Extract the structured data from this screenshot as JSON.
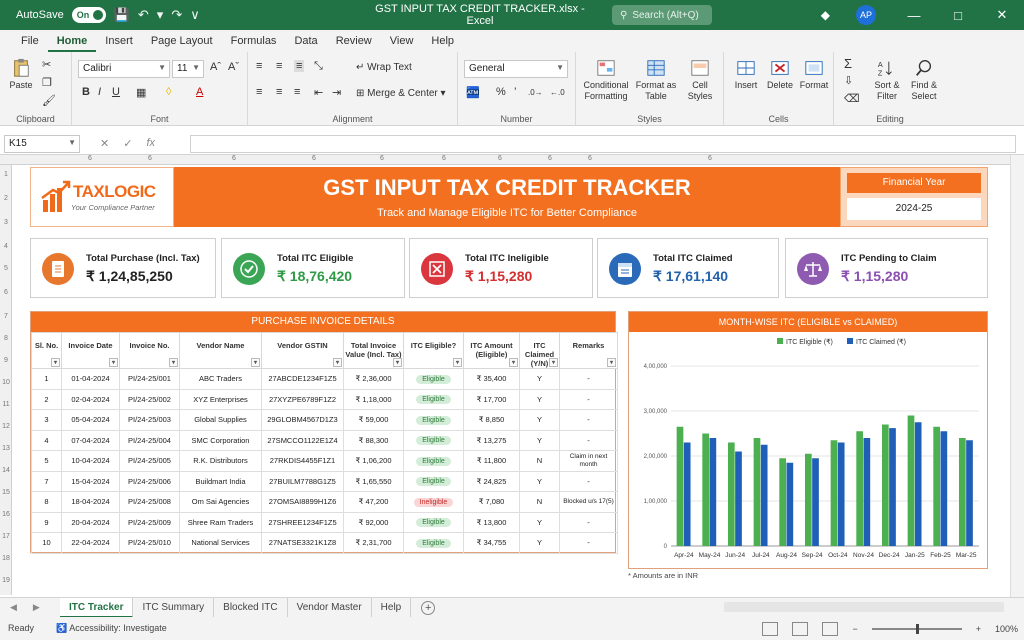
{
  "titlebar": {
    "autosave_label": "AutoSave",
    "toggle_state": "On",
    "filename": "GST INPUT TAX CREDIT TRACKER.xlsx",
    "app_name": "Excel",
    "separator": "-",
    "search_placeholder": "Search (Alt+Q)",
    "avatar_initials": "AP"
  },
  "menu": {
    "tabs": [
      "File",
      "Home",
      "Insert",
      "Page Layout",
      "Formulas",
      "Data",
      "Review",
      "View",
      "Help"
    ],
    "active": "Home"
  },
  "ribbon": {
    "clipboard": {
      "paste": "Paste",
      "label": "Clipboard"
    },
    "font": {
      "name": "Calibri",
      "size": "11",
      "label": "Font"
    },
    "alignment": {
      "wrap_text": "Wrap Text",
      "merge_center": "Merge & Center",
      "label": "Alignment"
    },
    "number": {
      "format": "General",
      "label": "Number"
    },
    "styles": {
      "conditional": "Conditional Formatting",
      "format_table": "Format as Table",
      "cell_styles": "Cell Styles",
      "label": "Styles"
    },
    "cells": {
      "insert": "Insert",
      "delete": "Delete",
      "format": "Format",
      "label": "Cells"
    },
    "editing": {
      "sort_filter": "Sort & Filter",
      "find_select": "Find & Select",
      "label": "Editing"
    }
  },
  "formula_bar": {
    "name_box": "K15",
    "fx": "fx",
    "content": ""
  },
  "column_headers": [
    "6",
    "6",
    "6",
    "6",
    "6",
    "6",
    "6",
    "6",
    "6",
    "6"
  ],
  "row_headers": [
    "1",
    "2",
    "3",
    "4",
    "5",
    "6",
    "7",
    "8",
    "9",
    "10",
    "11",
    "12",
    "13",
    "14",
    "15",
    "16",
    "17",
    "18",
    "19"
  ],
  "banner": {
    "logo_name": "TAXLOGIC",
    "logo_tagline": "Your Compliance Partner",
    "title": "GST INPUT TAX CREDIT TRACKER",
    "subtitle": "Track and Manage Eligible ITC for Better Compliance",
    "fy_label": "Financial Year",
    "fy_value": "2024-25"
  },
  "kpis": [
    {
      "label": "Total Purchase (Incl. Tax)",
      "value": "₹ 1,24,85,250",
      "icon": "document-icon",
      "color": "#e8772e",
      "value_color": "#222222"
    },
    {
      "label": "Total ITC Eligible",
      "value": "₹ 18,76,420",
      "icon": "check-icon",
      "color": "#3aa655",
      "value_color": "#2e9a45"
    },
    {
      "label": "Total ITC Ineligible",
      "value": "₹ 1,15,280",
      "icon": "cross-icon",
      "color": "#d9363e",
      "value_color": "#d32f2f"
    },
    {
      "label": "Total ITC Claimed",
      "value": "₹ 17,61,140",
      "icon": "calendar-icon",
      "color": "#2a6ab8",
      "value_color": "#2262ad"
    },
    {
      "label": "ITC Pending to Claim",
      "value": "₹ 1,15,280",
      "icon": "scale-icon",
      "color": "#8e5bb0",
      "value_color": "#8a4fb0"
    }
  ],
  "invoice_table": {
    "title": "PURCHASE INVOICE DETAILS",
    "columns": [
      "Sl. No.",
      "Invoice Date",
      "Invoice No.",
      "Vendor Name",
      "Vendor GSTIN",
      "Total Invoice Value (Incl. Tax)",
      "ITC Eligible?",
      "ITC Amount (Eligible)",
      "ITC Claimed (Y/N)",
      "Remarks"
    ],
    "rows": [
      [
        "1",
        "01-04-2024",
        "PI/24-25/001",
        "ABC Traders",
        "27ABCDE1234F1Z5",
        "₹ 2,36,000",
        "Eligible",
        "₹ 35,400",
        "Y",
        "-"
      ],
      [
        "2",
        "02-04-2024",
        "PI/24-25/002",
        "XYZ Enterprises",
        "27XYZPE6789F1Z2",
        "₹ 1,18,000",
        "Eligible",
        "₹ 17,700",
        "Y",
        "-"
      ],
      [
        "3",
        "05-04-2024",
        "PI/24-25/003",
        "Global Supplies",
        "29GLOBM4567D1Z3",
        "₹ 59,000",
        "Eligible",
        "₹ 8,850",
        "Y",
        "-"
      ],
      [
        "4",
        "07-04-2024",
        "PI/24-25/004",
        "SMC Corporation",
        "27SMCCO1122E1Z4",
        "₹ 88,300",
        "Eligible",
        "₹ 13,275",
        "Y",
        "-"
      ],
      [
        "5",
        "10-04-2024",
        "PI/24-25/005",
        "R.K. Distributors",
        "27RKDIS4455F1Z1",
        "₹ 1,06,200",
        "Eligible",
        "₹ 11,800",
        "N",
        "Claim in next month"
      ],
      [
        "7",
        "15-04-2024",
        "PI/24-25/006",
        "Buildmart India",
        "27BUILM7788G1Z5",
        "₹ 1,65,550",
        "Eligible",
        "₹ 24,825",
        "Y",
        "-"
      ],
      [
        "8",
        "18-04-2024",
        "PI/24-25/008",
        "Om Sai Agencies",
        "27OMSAI8899H1Z6",
        "₹ 47,200",
        "Ineligible",
        "₹ 7,080",
        "N",
        "Blocked u/s 17(5)"
      ],
      [
        "9",
        "20-04-2024",
        "PI/24-25/009",
        "Shree Ram Traders",
        "27SHREE1234F1Z5",
        "₹ 92,000",
        "Eligible",
        "₹ 13,800",
        "Y",
        "-"
      ],
      [
        "10",
        "22-04-2024",
        "PI/24-25/010",
        "National Services",
        "27NATSE3321K1Z8",
        "₹ 2,31,700",
        "Eligible",
        "₹ 34,755",
        "Y",
        "-"
      ]
    ]
  },
  "chart_data": {
    "type": "bar",
    "title": "MONTH-WISE ITC (ELIGIBLE vs CLAIMED)",
    "categories": [
      "Apr-24",
      "May-24",
      "Jun-24",
      "Jul-24",
      "Aug-24",
      "Sep-24",
      "Oct-24",
      "Nov-24",
      "Dec-24",
      "Jan-25",
      "Feb-25",
      "Mar-25"
    ],
    "series": [
      {
        "name": "ITC Eligible (₹)",
        "color": "#4caf50",
        "values": [
          265000,
          250000,
          230000,
          240000,
          195000,
          205000,
          235000,
          255000,
          270000,
          290000,
          265000,
          240000
        ]
      },
      {
        "name": "ITC Claimed (₹)",
        "color": "#1f5fb8",
        "values": [
          230000,
          240000,
          210000,
          225000,
          185000,
          195000,
          230000,
          240000,
          262000,
          275000,
          255000,
          235000
        ]
      }
    ],
    "ylim": [
      0,
      400000
    ],
    "yticks": [
      "0",
      "1,00,000",
      "2,00,000",
      "3,00,000",
      "4,00,000"
    ],
    "legend": "top-right",
    "note": "* Amounts are in INR"
  },
  "sheet_tabs": {
    "tabs": [
      "ITC Tracker",
      "ITC Summary",
      "Blocked ITC",
      "Vendor Master",
      "Help"
    ],
    "active": "ITC Tracker"
  },
  "status": {
    "ready": "Ready",
    "accessibility": "Accessibility: Investigate",
    "zoom": "100%"
  }
}
